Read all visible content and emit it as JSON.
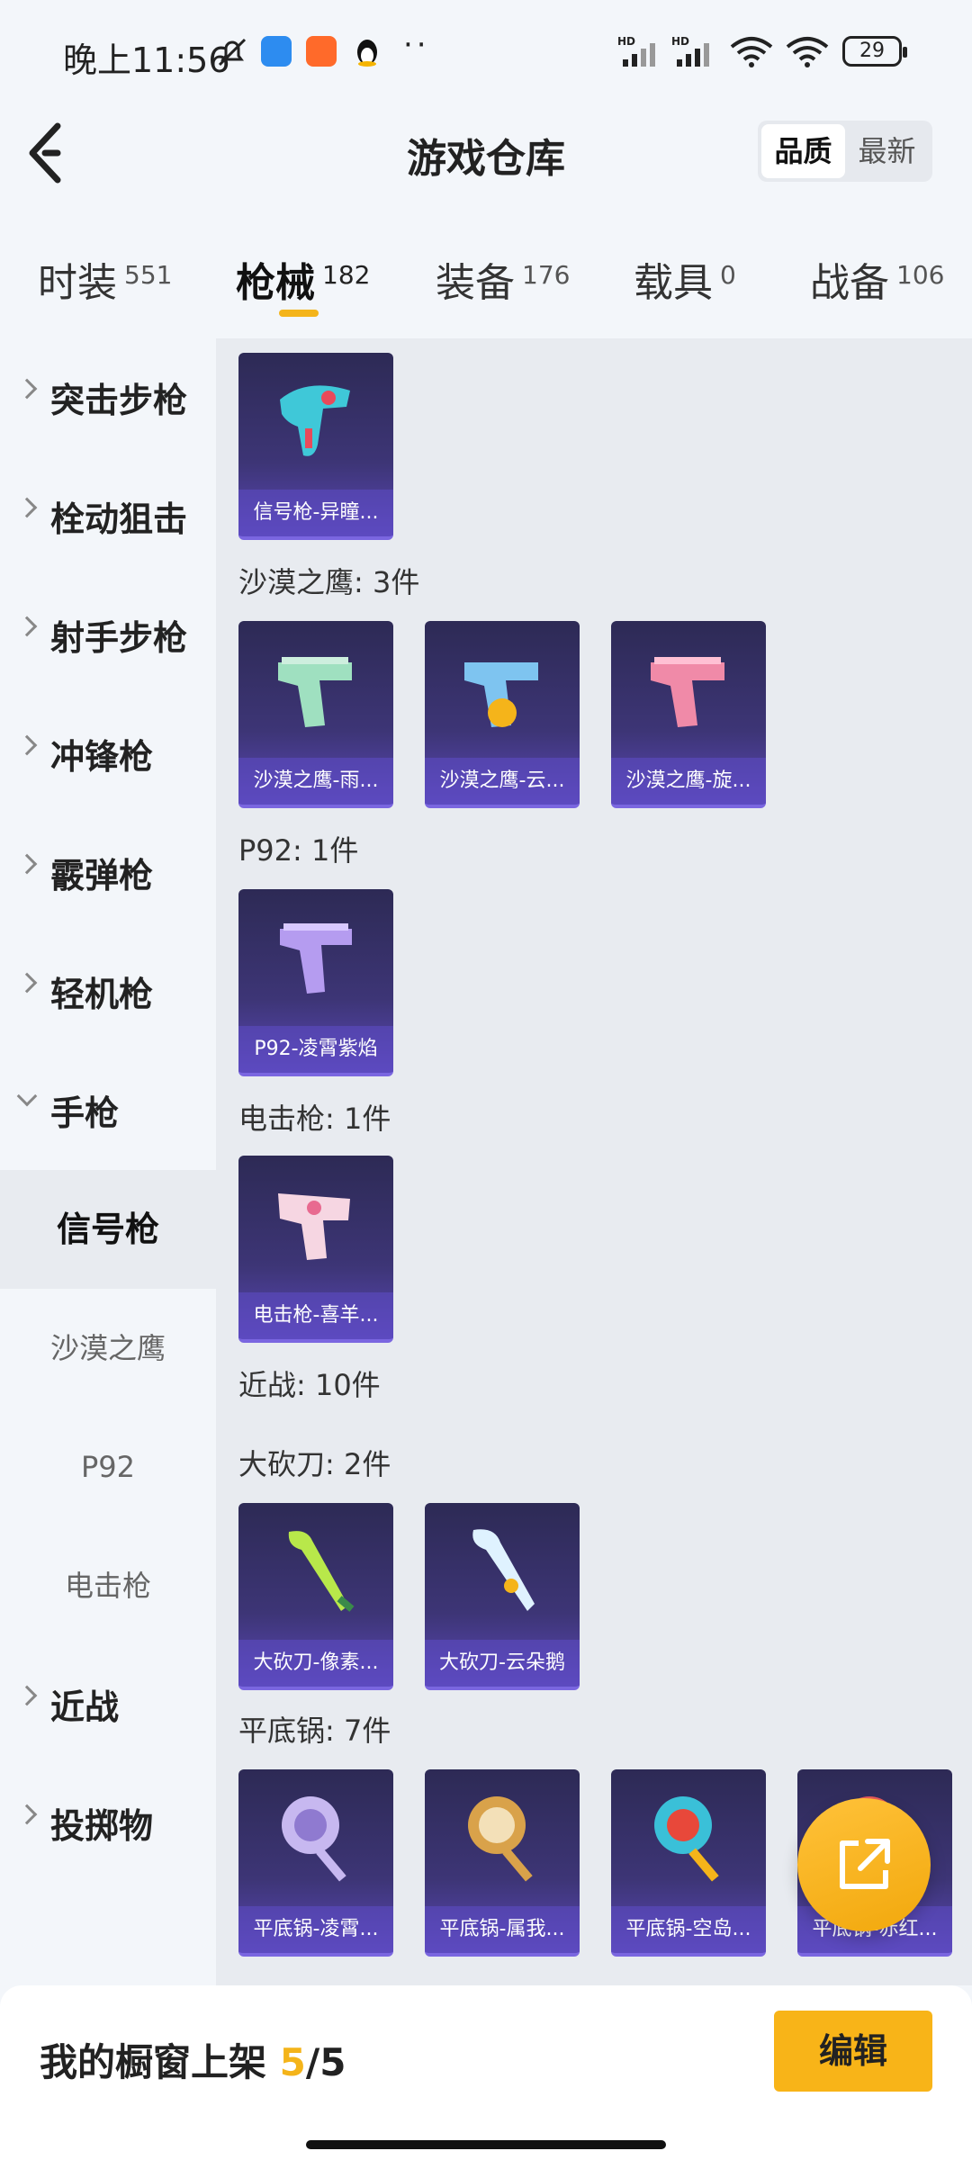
{
  "status": {
    "time": "晚上11:56",
    "battery": "29"
  },
  "header": {
    "title": "游戏仓库",
    "sort_options": [
      "品质",
      "最新"
    ]
  },
  "tabs": [
    {
      "label": "时装",
      "count": "551"
    },
    {
      "label": "枪械",
      "count": "182"
    },
    {
      "label": "装备",
      "count": "176"
    },
    {
      "label": "载具",
      "count": "0"
    },
    {
      "label": "战备",
      "count": "106"
    }
  ],
  "sidebar": {
    "categories": [
      "突击步枪",
      "栓动狙击",
      "射手步枪",
      "冲锋枪",
      "霰弹枪",
      "轻机枪",
      "手枪",
      "近战",
      "投掷物"
    ],
    "subcategories": [
      "信号枪",
      "沙漠之鹰",
      "P92",
      "电击枪"
    ]
  },
  "groups": {
    "desert_eagle": "沙漠之鹰: 3件",
    "p92": "P92: 1件",
    "stun": "电击枪: 1件",
    "melee": "近战: 10件",
    "machete": "大砍刀: 2件",
    "pan": "平底锅: 7件"
  },
  "items": {
    "flare": "信号枪-异瞳...",
    "de1": "沙漠之鹰-雨...",
    "de2": "沙漠之鹰-云...",
    "de3": "沙漠之鹰-旋...",
    "p92": "P92-凌霄紫焰",
    "stun": "电击枪-喜羊...",
    "machete1": "大砍刀-像素...",
    "machete2": "大砍刀-云朵鹅",
    "pan1": "平底锅-凌霄...",
    "pan2": "平底锅-属我...",
    "pan3": "平底锅-空岛...",
    "pan4": "平底锅-赤红..."
  },
  "bottom": {
    "label": "我的橱窗上架",
    "current": "5",
    "total": "/5",
    "edit": "编辑"
  }
}
